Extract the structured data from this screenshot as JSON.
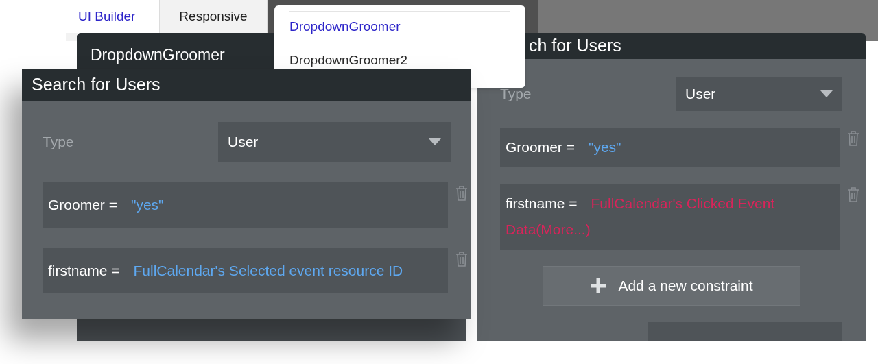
{
  "tabs": [
    {
      "label": "UI Builder",
      "selected": true
    },
    {
      "label": "Responsive",
      "selected": false
    }
  ],
  "back_panel": {
    "title": "DropdownGroomer"
  },
  "dropdown_menu": {
    "items": [
      {
        "label": "DropdownGroomer",
        "selected": true
      },
      {
        "label": "DropdownGroomer2",
        "selected": false
      }
    ]
  },
  "search_panels": [
    {
      "title": "ch for Users",
      "type_label": "Type",
      "type_value": "User",
      "constraints": [
        {
          "field": "Groomer =",
          "value": "\"yes\"",
          "kind": "dynamic"
        },
        {
          "field": "firstname =",
          "value": "FullCalendar's Clicked Event Data(More...)",
          "kind": "error"
        }
      ],
      "add_button": "Add a new constraint"
    },
    {
      "title": "Search for Users",
      "type_label": "Type",
      "type_value": "User",
      "constraints": [
        {
          "field": "Groomer =",
          "value": "\"yes\"",
          "kind": "dynamic"
        },
        {
          "field": "firstname =",
          "value": "FullCalendar's Selected event resource ID",
          "kind": "dynamic"
        }
      ]
    }
  ]
}
